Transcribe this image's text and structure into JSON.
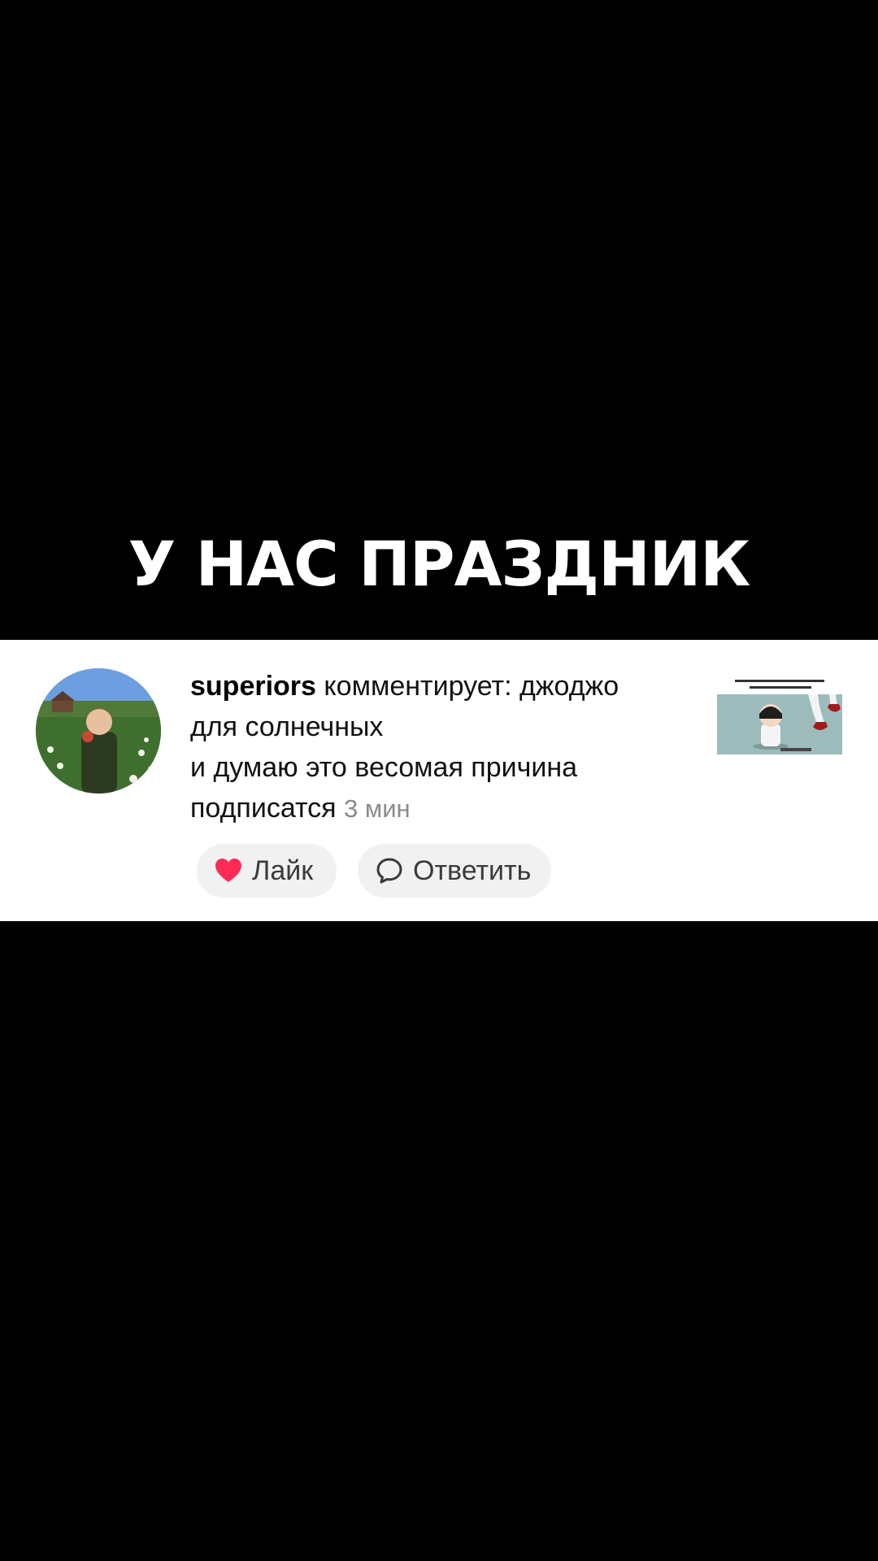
{
  "video": {
    "caption": "У НАС ПРАЗДНИК"
  },
  "comment": {
    "username": "superiors",
    "action": " комментирует: ",
    "line1": "джоджо",
    "line2": "для солнечных",
    "line3": "и думаю это весомая причина",
    "line4": "подписатся",
    "time": "3 мин"
  },
  "actions": {
    "like_label": "Лайк",
    "reply_label": "Ответить"
  },
  "icons": {
    "like": "heart-icon",
    "reply": "speech-bubble-icon"
  },
  "colors": {
    "heart": "#fe2c55",
    "background": "#000000",
    "card": "#ffffff",
    "pill": "#f1f1f2"
  }
}
